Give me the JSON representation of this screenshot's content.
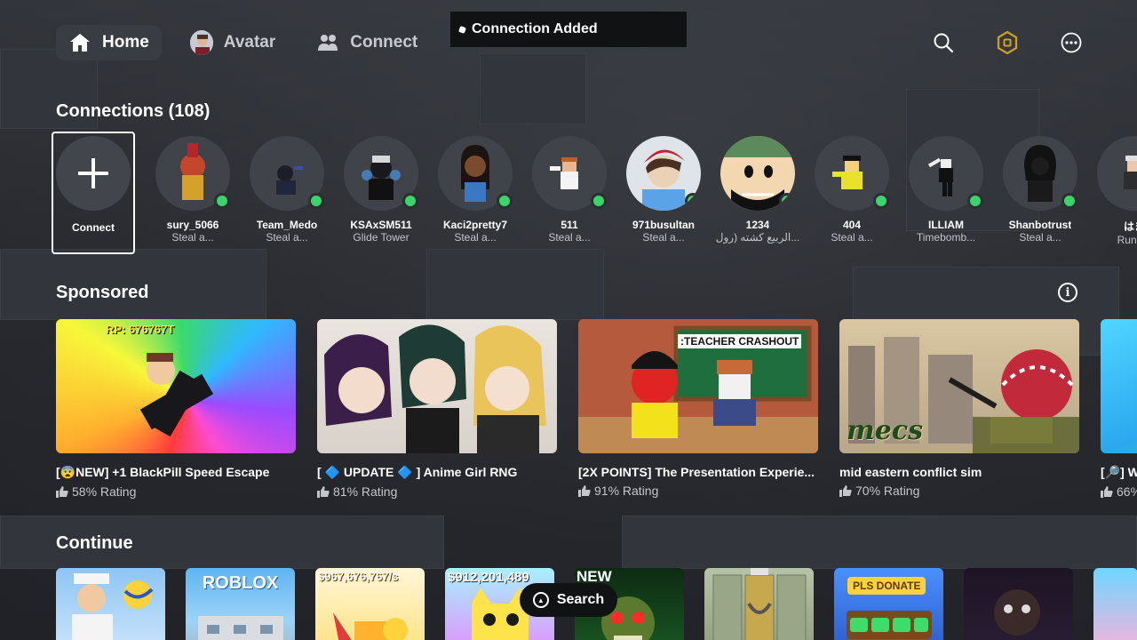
{
  "nav": {
    "home": "Home",
    "avatar": "Avatar",
    "connect": "Connect"
  },
  "toast": {
    "text": "Connection Added"
  },
  "icons": {
    "home": "home-icon",
    "avatar": "avatar-thumbnail",
    "connect": "people-icon",
    "search": "search-icon",
    "robux": "robux-icon",
    "more": "more-icon"
  },
  "connections": {
    "title": "Connections (108)",
    "connect_label": "Connect",
    "friends": [
      {
        "name": "sury_5066",
        "status": "Steal a..."
      },
      {
        "name": "Team_Medo",
        "status": "Steal a..."
      },
      {
        "name": "KSAxSM511",
        "status": "Glide Tower"
      },
      {
        "name": "Kaci2pretty7",
        "status": "Steal a..."
      },
      {
        "name": "511",
        "status": "Steal a..."
      },
      {
        "name": "971busultan",
        "status": "Steal a..."
      },
      {
        "name": "1234",
        "status": "الربيع كشته (رول..."
      },
      {
        "name": "404",
        "status": "Steal a..."
      },
      {
        "name": "ILLIAM",
        "status": "Timebomb..."
      },
      {
        "name": "Shanbotrust",
        "status": "Steal a..."
      },
      {
        "name": "はま",
        "status": "Run on"
      }
    ]
  },
  "sponsored": {
    "title": "Sponsored",
    "info": "i",
    "games": [
      {
        "title": "[😨NEW] +1 BlackPill Speed Escape",
        "rating": "58% Rating",
        "thumb_text": "RP: 676767T"
      },
      {
        "title": "[ 🔷 UPDATE 🔷 ] Anime Girl RNG",
        "rating": "81% Rating",
        "thumb_text": ""
      },
      {
        "title": "[2X POINTS] The Presentation Experie...",
        "rating": "91% Rating",
        "thumb_text": ":TEACHER CRASHOUT"
      },
      {
        "title": "mid eastern conflict sim",
        "rating": "70% Rating",
        "thumb_text": "mecs"
      },
      {
        "title": "[🔎] W",
        "rating": "66%",
        "thumb_text": ""
      }
    ]
  },
  "continue": {
    "title": "Continue",
    "items": [
      {
        "label": ""
      },
      {
        "label": "ROBLOX"
      },
      {
        "label": "$967,676,767/s"
      },
      {
        "label": "$912,201,489"
      },
      {
        "label": "NEW"
      },
      {
        "label": ""
      },
      {
        "label": "PLS DONATE"
      },
      {
        "label": ""
      },
      {
        "label": ""
      }
    ]
  },
  "search_pill": {
    "label": "Search"
  },
  "colors": {
    "background": "#2b2d33",
    "online": "#39d56b",
    "toast_bg": "#111214",
    "robux": "#c9a227"
  }
}
